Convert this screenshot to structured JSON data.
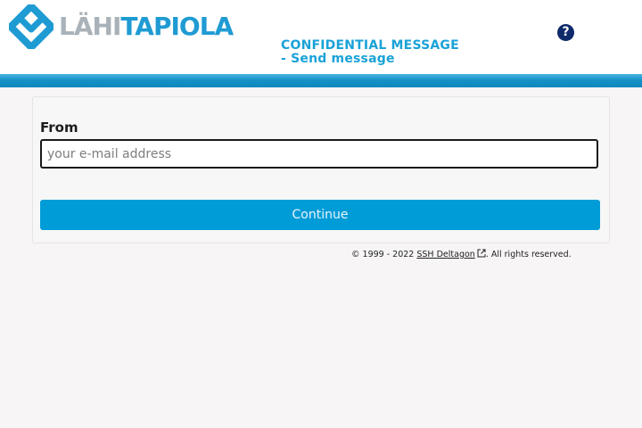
{
  "header": {
    "logo": {
      "text_part1": "LÄHI",
      "text_part2": "TAPIOLA",
      "icon": "lahitapiola-logo-icon"
    },
    "title_line1": "CONFIDENTIAL MESSAGE",
    "title_line2": "- Send message",
    "help": {
      "label": "?",
      "icon": "help-icon"
    }
  },
  "form": {
    "from_label": "From",
    "email_placeholder": "your e-mail address",
    "email_value": "",
    "continue_label": "Continue"
  },
  "footer": {
    "copyright": "© 1999 - 2022",
    "link_text": "SSH Deltagon",
    "link_icon": "external-link-icon",
    "rights": ". All rights reserved."
  },
  "colors": {
    "brand_blue": "#1f9bd3",
    "button": "#009cd8",
    "help_bg": "#0f2a6b",
    "logo_gray": "#a9b2b9"
  }
}
